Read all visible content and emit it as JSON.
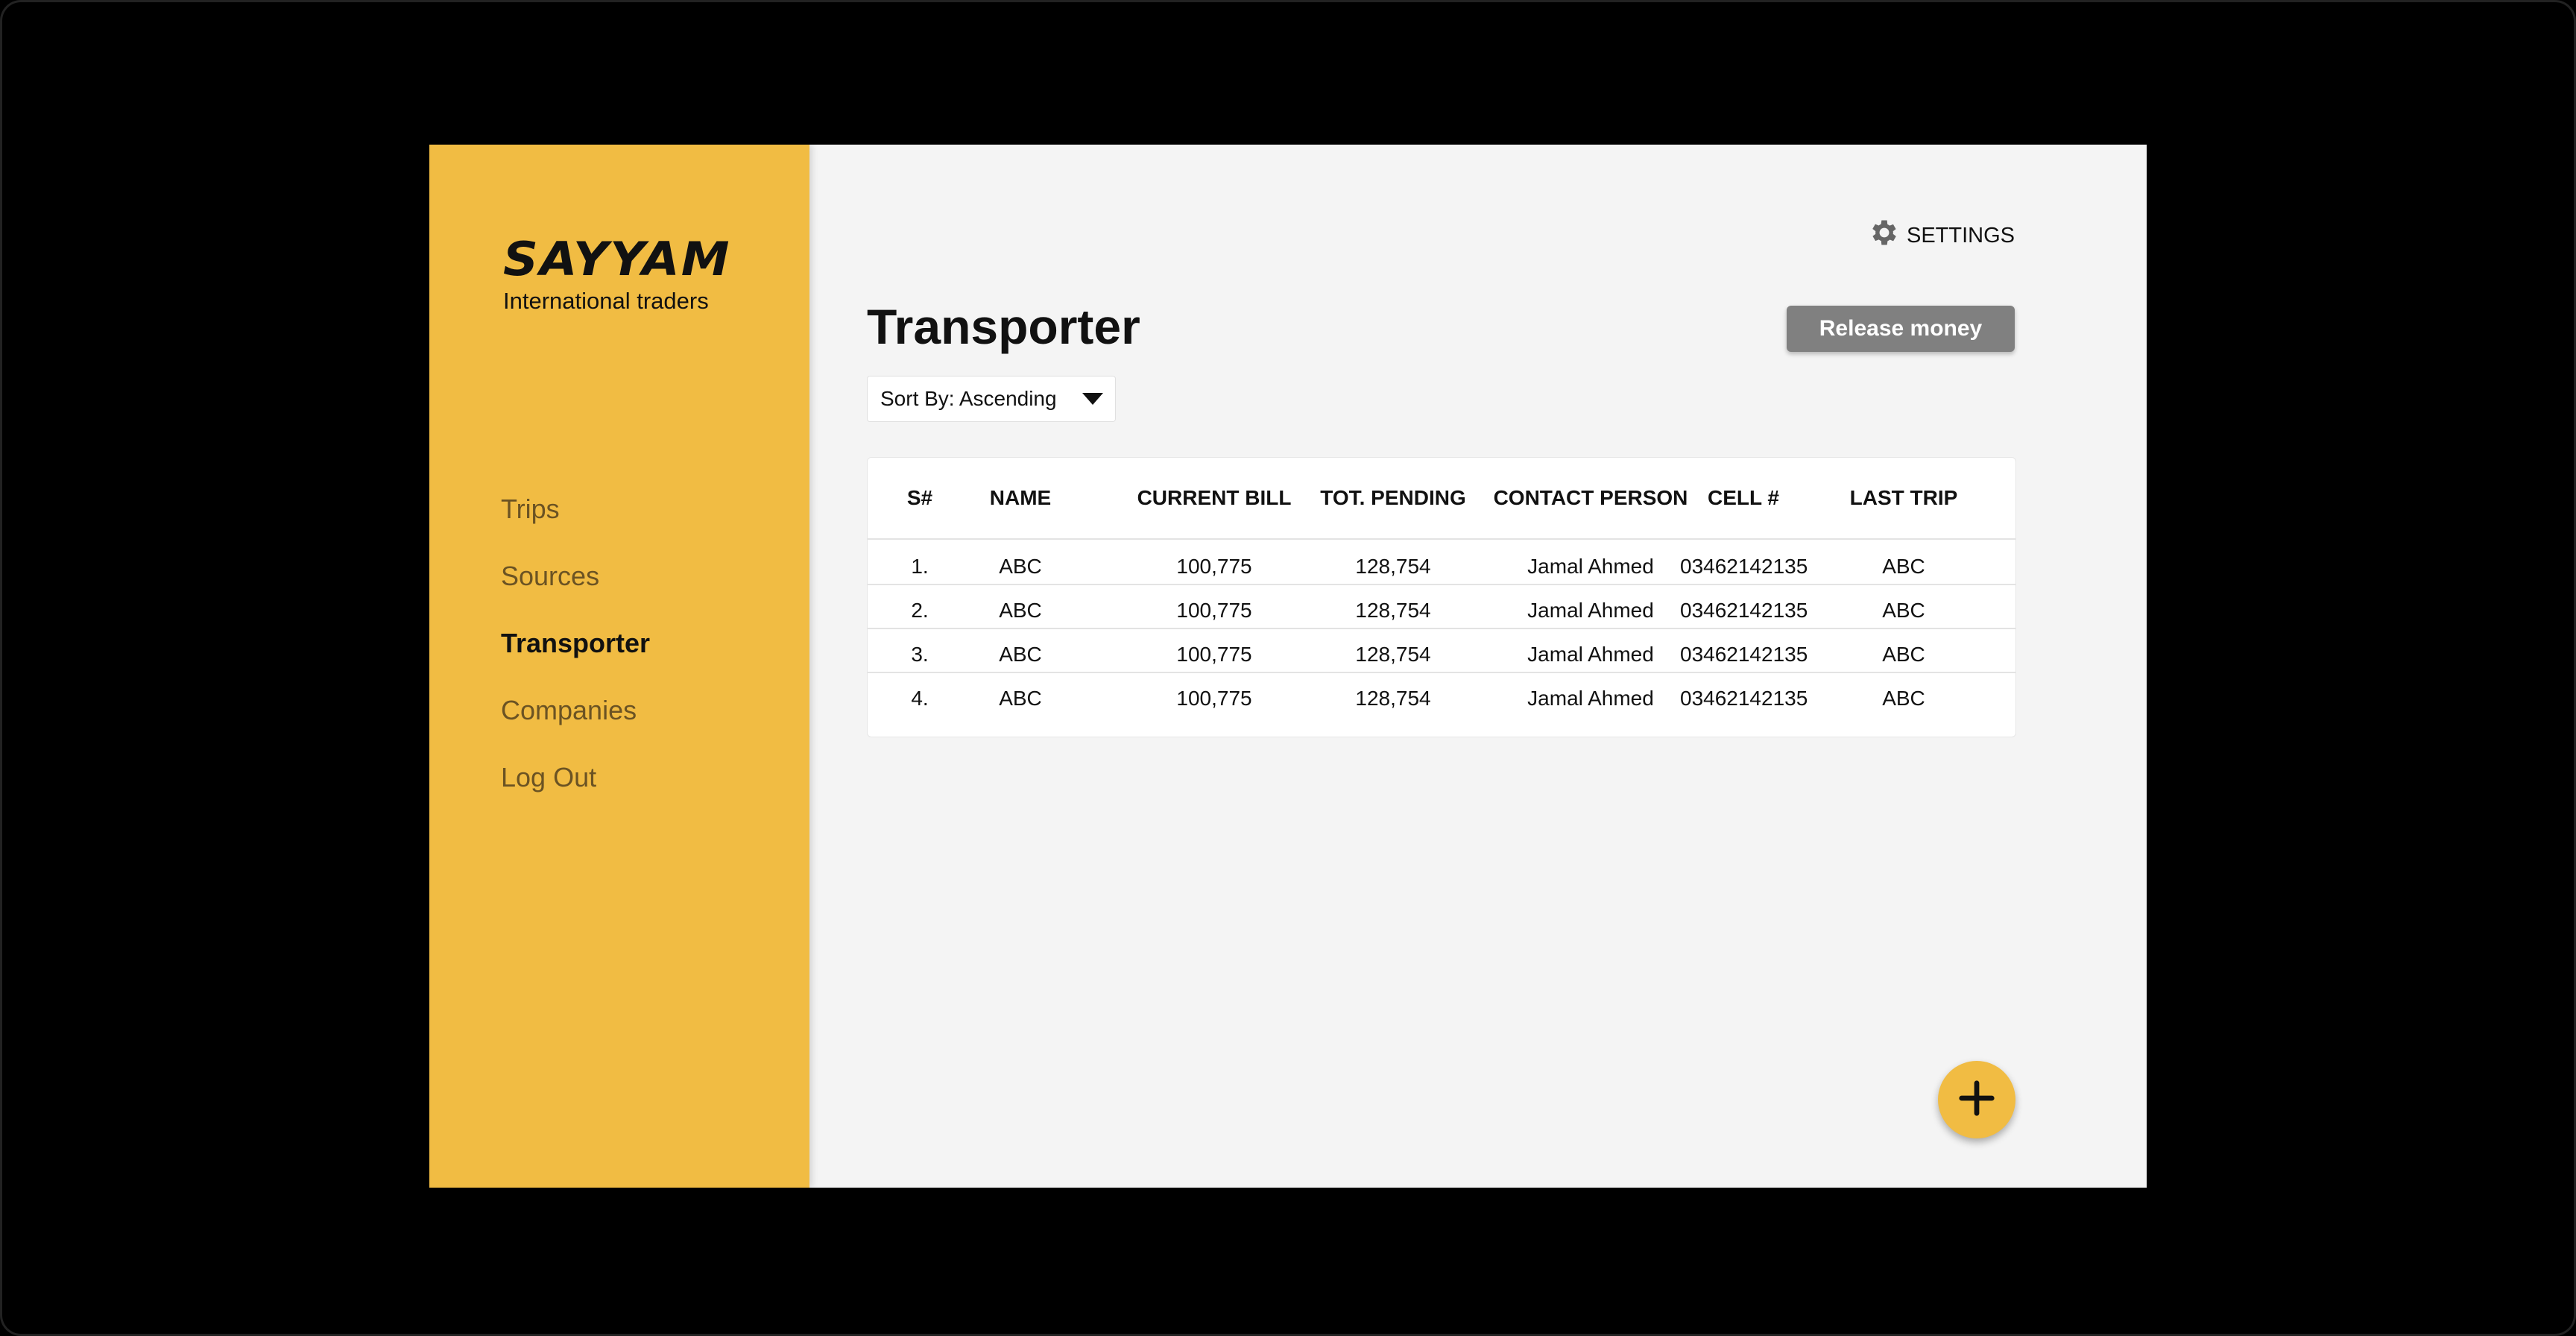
{
  "brand": {
    "name": "SAYYAM",
    "tagline": "International traders"
  },
  "sidebar": {
    "items": [
      {
        "label": "Trips",
        "active": false
      },
      {
        "label": "Sources",
        "active": false
      },
      {
        "label": "Transporter",
        "active": true
      },
      {
        "label": "Companies",
        "active": false
      },
      {
        "label": "Log Out",
        "active": false
      }
    ]
  },
  "header": {
    "settings_label": "SETTINGS",
    "title": "Transporter",
    "release_label": "Release money"
  },
  "sort": {
    "label": "Sort By: Ascending"
  },
  "table": {
    "columns": [
      "S#",
      "NAME",
      "CURRENT BILL",
      "TOT. PENDING",
      "CONTACT PERSON",
      "CELL #",
      "LAST TRIP"
    ],
    "rows": [
      [
        "1.",
        "ABC",
        "100,775",
        "128,754",
        "Jamal Ahmed",
        "03462142135",
        "ABC"
      ],
      [
        "2.",
        "ABC",
        "100,775",
        "128,754",
        "Jamal Ahmed",
        "03462142135",
        "ABC"
      ],
      [
        "3.",
        "ABC",
        "100,775",
        "128,754",
        "Jamal Ahmed",
        "03462142135",
        "ABC"
      ],
      [
        "4.",
        "ABC",
        "100,775",
        "128,754",
        "Jamal Ahmed",
        "03462142135",
        "ABC"
      ]
    ]
  },
  "icons": {
    "settings": "gear-icon",
    "sort": "caret-down-icon",
    "add": "plus-icon"
  },
  "colors": {
    "accent": "#f1bc43",
    "button": "#808080",
    "background": "#f4f4f4"
  }
}
